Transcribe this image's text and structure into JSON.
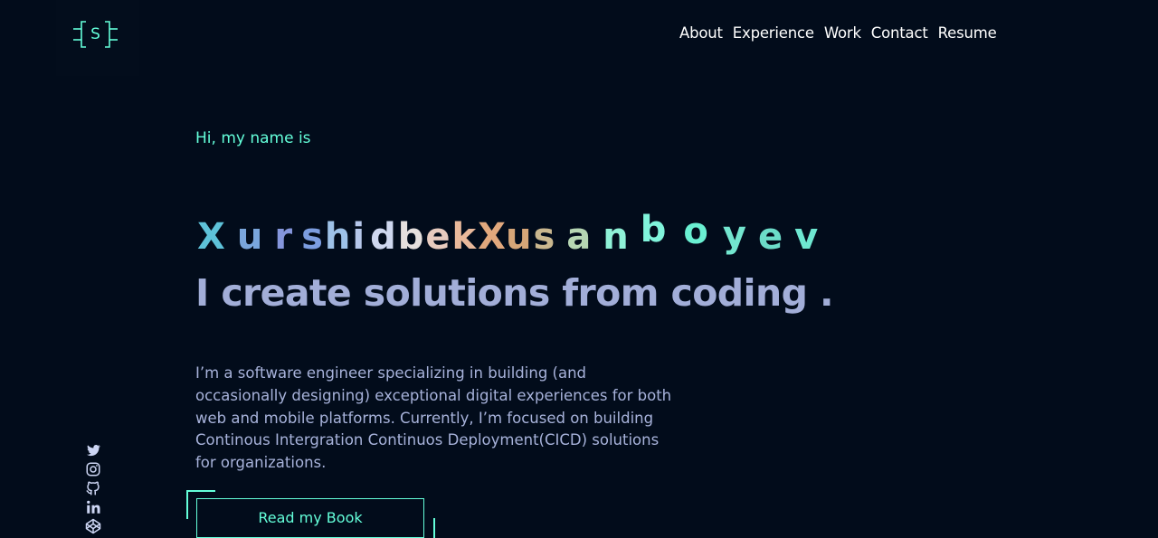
{
  "logo": {
    "letter": "S",
    "icon": "bracket-logo-icon"
  },
  "nav": {
    "items": [
      "About",
      "Experience",
      "Work",
      "Contact",
      "Resume"
    ]
  },
  "hero": {
    "greeting": "Hi, my name is",
    "name": "XurshidbekXusanboyev",
    "name_colors": [
      "#5ec2d9",
      "#7aa6dc",
      "#8596dc",
      "#7c9de0",
      "#9ec2e8",
      "#b6c7ea",
      "#cfd8ef",
      "#e6e0de",
      "#e7cbbf",
      "#e9b99b",
      "#e1a87d",
      "#d6a678",
      "#c9b78f",
      "#b6d6b3",
      "#8ff2d7",
      "#80f4db",
      "#6af0d2",
      "#73e6cf",
      "#6cdcc9",
      "#6ee7d1"
    ],
    "tagline": "I create solutions from coding .",
    "bio_lines": [
      "I’m a software engineer specializing in building (and",
      "occasionally designing) exceptional digital experiences for both",
      "web and mobile platforms. Currently, I’m focused on building",
      "Continous Intergration Continuos Deployment(CICD) solutions",
      "for organizations."
    ],
    "cta": "Read my Book"
  },
  "social": [
    "twitter-icon",
    "instagram-icon",
    "github-icon",
    "linkedin-icon",
    "codepen-icon"
  ],
  "colors": {
    "background": "#020c1b",
    "accent": "#64ffda",
    "text": "#a7b2da",
    "nav_text": "#ffffff"
  }
}
